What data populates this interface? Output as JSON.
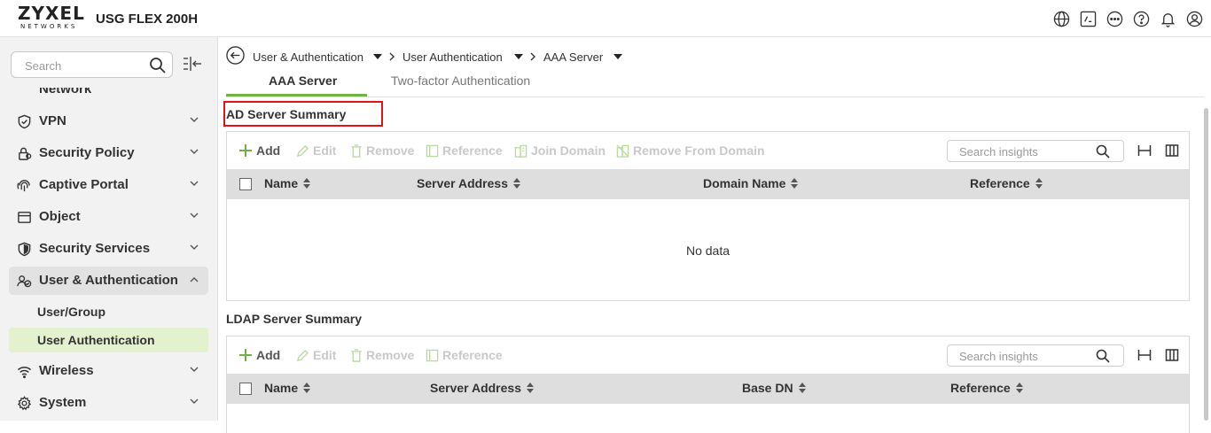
{
  "header": {
    "logo_main": "ZYXEL",
    "logo_sub": "NETWORKS",
    "model": "USG FLEX 200H",
    "icons": [
      "globe-icon",
      "cli-icon",
      "more-icon",
      "help-icon",
      "bell-icon",
      "user-icon"
    ]
  },
  "sidebar": {
    "search_placeholder": "Search",
    "partial_item": "Network",
    "items": [
      {
        "label": "VPN",
        "icon": "shield-check-icon",
        "expanded": false
      },
      {
        "label": "Security Policy",
        "icon": "lock-icon",
        "expanded": false
      },
      {
        "label": "Captive Portal",
        "icon": "fingerprint-icon",
        "expanded": false
      },
      {
        "label": "Object",
        "icon": "box-icon",
        "expanded": false
      },
      {
        "label": "Security Services",
        "icon": "shield-icon",
        "expanded": false
      },
      {
        "label": "User & Authentication",
        "icon": "users-icon",
        "expanded": true
      },
      {
        "label": "Wireless",
        "icon": "wifi-icon",
        "expanded": false
      },
      {
        "label": "System",
        "icon": "gear-icon",
        "expanded": false
      }
    ],
    "sub_items": [
      {
        "label": "User/Group",
        "selected": false
      },
      {
        "label": "User Authentication",
        "selected": true
      }
    ]
  },
  "breadcrumb": [
    "User & Authentication",
    "User Authentication",
    "AAA Server"
  ],
  "tabs": [
    {
      "label": "AAA Server",
      "active": true
    },
    {
      "label": "Two-factor Authentication",
      "active": false
    }
  ],
  "ad": {
    "title": "AD Server Summary",
    "toolbar": {
      "add": "Add",
      "edit": "Edit",
      "remove": "Remove",
      "reference": "Reference",
      "join": "Join Domain",
      "remove_domain": "Remove From Domain"
    },
    "search_placeholder": "Search insights",
    "columns": [
      "Name",
      "Server Address",
      "Domain Name",
      "Reference"
    ],
    "empty_text": "No data"
  },
  "ldap": {
    "title": "LDAP Server Summary",
    "toolbar": {
      "add": "Add",
      "edit": "Edit",
      "remove": "Remove",
      "reference": "Reference"
    },
    "search_placeholder": "Search insights",
    "columns": [
      "Name",
      "Server Address",
      "Base DN",
      "Reference"
    ]
  },
  "colors": {
    "accent": "#72b043",
    "highlight": "#e0121a",
    "selected_bg": "#e3f1cf"
  }
}
